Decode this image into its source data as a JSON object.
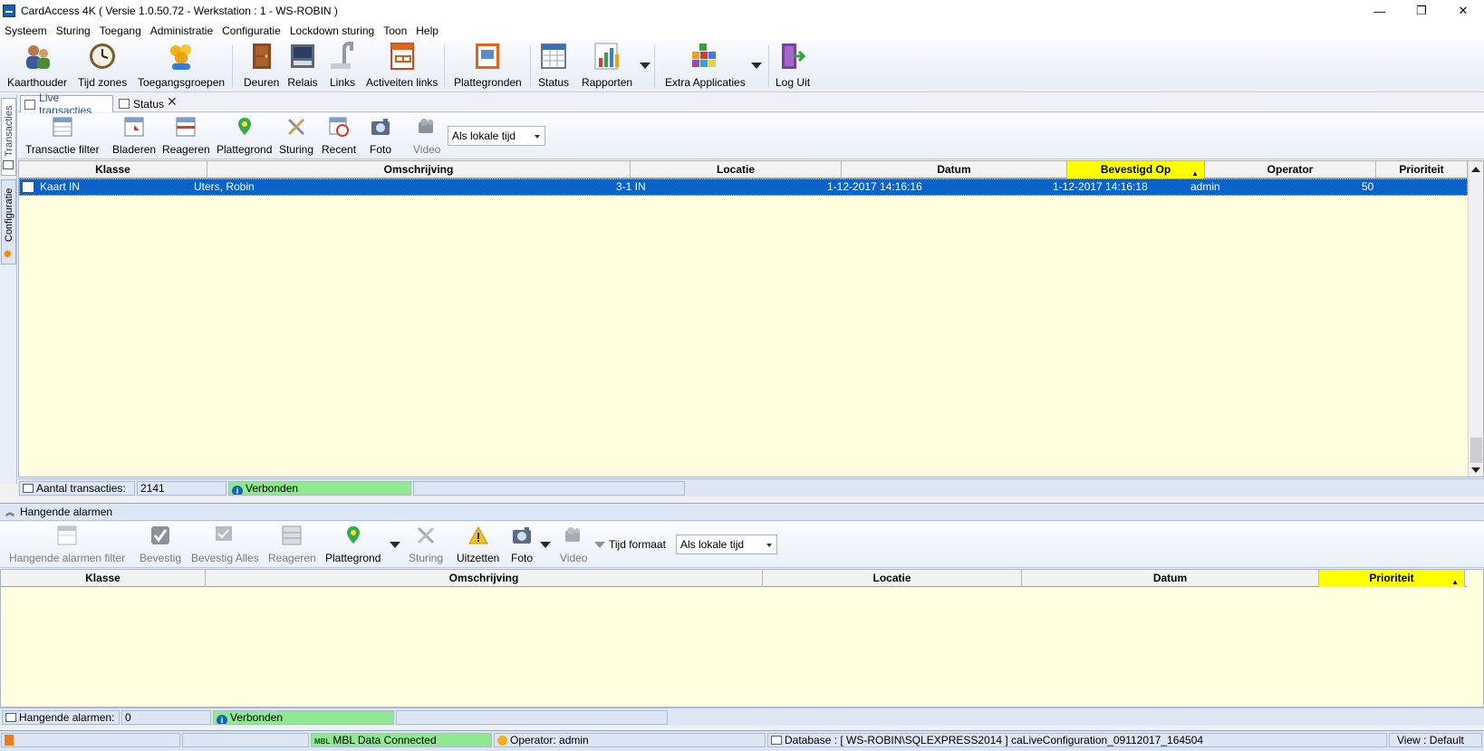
{
  "window": {
    "title": "CardAccess 4K ( Versie 1.0.50.72  -  Werkstation : 1 - WS-ROBIN )",
    "minimize_glyph": "—",
    "restore_glyph": "❐",
    "close_glyph": "✕"
  },
  "menu": [
    "Systeem",
    "Sturing",
    "Toegang",
    "Administratie",
    "Configuratie",
    "Lockdown sturing",
    "Toon",
    "Help"
  ],
  "toolbar": [
    {
      "label": "Kaarthouder",
      "icon": "cardholder-icon"
    },
    {
      "label": "Tijd zones",
      "icon": "clock-icon"
    },
    {
      "label": "Toegangsgroepen",
      "icon": "access-groups-icon"
    },
    {
      "label": "Deuren",
      "icon": "door-icon"
    },
    {
      "label": "Relais",
      "icon": "relay-icon"
    },
    {
      "label": "Links",
      "icon": "links-icon"
    },
    {
      "label": "Activeiten links",
      "icon": "activity-links-icon"
    },
    {
      "label": "Plattegronden",
      "icon": "floorplans-icon"
    },
    {
      "label": "Status",
      "icon": "status-icon"
    },
    {
      "label": "Rapporten",
      "icon": "reports-icon"
    },
    {
      "label": "Extra Applicaties",
      "icon": "extra-apps-icon"
    },
    {
      "label": "Log Uit",
      "icon": "logout-icon"
    }
  ],
  "side_tabs": {
    "transacties": "Transacties",
    "configuratie": "Configuratie"
  },
  "doc_tabs": {
    "live": "Live transacties",
    "status": "Status",
    "close": "✕"
  },
  "live": {
    "toolbar": [
      {
        "label": "Transactie filter",
        "enabled": true
      },
      {
        "label": "Bladeren",
        "enabled": true
      },
      {
        "label": "Reageren",
        "enabled": true
      },
      {
        "label": "Plattegrond",
        "enabled": true
      },
      {
        "label": "Sturing",
        "enabled": true
      },
      {
        "label": "Recent",
        "enabled": true
      },
      {
        "label": "Foto",
        "enabled": true
      },
      {
        "label": "Video",
        "enabled": true
      }
    ],
    "time_combo": "Als lokale tijd",
    "columns": [
      "Klasse",
      "Omschrijving",
      "Locatie",
      "Datum",
      "Bevestigd Op",
      "Operator",
      "Prioriteit"
    ],
    "sorted_column": "Bevestigd Op",
    "sort_glyph": "▲",
    "rows": [
      {
        "klasse": "Kaart IN",
        "omschrijving": "Uters, Robin",
        "locatie": "3-1 IN",
        "datum": "1-12-2017 14:16:16",
        "bevestigd_op": "1-12-2017 14:16:18",
        "operator": "admin",
        "prioriteit": "50"
      }
    ],
    "status": {
      "label": "Aantal transacties:",
      "count": "2141",
      "connection": "Verbonden"
    }
  },
  "alarms": {
    "section_title": "Hangende alarmen",
    "toolbar": [
      {
        "label": "Hangende alarmen filter",
        "enabled": false
      },
      {
        "label": "Bevestig",
        "enabled": false
      },
      {
        "label": "Bevestig Alles",
        "enabled": false
      },
      {
        "label": "Reageren",
        "enabled": false
      },
      {
        "label": "Plattegrond",
        "enabled": true
      },
      {
        "label": "Sturing",
        "enabled": false
      },
      {
        "label": "Uitzetten",
        "enabled": true
      },
      {
        "label": "Foto",
        "enabled": true
      },
      {
        "label": "Video",
        "enabled": false
      }
    ],
    "time_format_label": "Tijd formaat",
    "time_combo": "Als lokale tijd",
    "columns": [
      "Klasse",
      "Omschrijving",
      "Locatie",
      "Datum",
      "Prioriteit"
    ],
    "sorted_column": "Prioriteit",
    "status": {
      "label": "Hangende alarmen:",
      "count": "0",
      "connection": "Verbonden"
    }
  },
  "bottom_status": {
    "mbl_badge": "MBL",
    "mbl": "MBL Data Connected",
    "operator": "Operator: admin",
    "database": "Database : [ WS-ROBIN\\SQLEXPRESS2014 ] caLiveConfiguration_09112017_164504",
    "view": "View : Default"
  },
  "colors": {
    "selection": "#0a63c9",
    "grid_bg": "#ffffdf",
    "sorted_header": "#ffff00",
    "connected": "#90e890"
  }
}
